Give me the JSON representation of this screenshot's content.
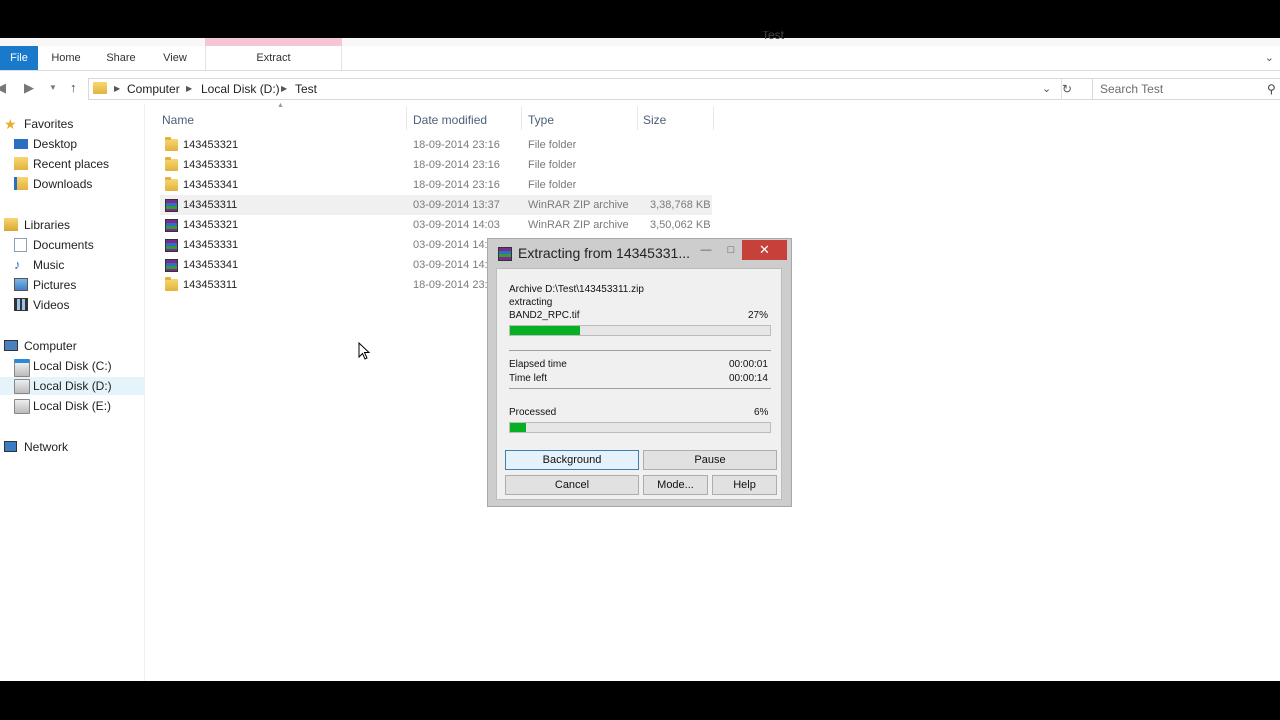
{
  "ribbon": {
    "tabs": [
      "File",
      "Home",
      "Share",
      "View",
      "Extract"
    ],
    "window_title": "Test"
  },
  "address": {
    "crumbs": [
      "Computer",
      "Local Disk (D:)",
      "Test"
    ],
    "search_placeholder": "Search Test"
  },
  "sidebar": {
    "favorites": "Favorites",
    "fav_items": [
      "Desktop",
      "Recent places",
      "Downloads"
    ],
    "libraries": "Libraries",
    "lib_items": [
      "Documents",
      "Music",
      "Pictures",
      "Videos"
    ],
    "computer": "Computer",
    "comp_items": [
      "Local Disk (C:)",
      "Local Disk (D:)",
      "Local Disk (E:)"
    ],
    "network": "Network"
  },
  "columns": {
    "name": "Name",
    "date": "Date modified",
    "type": "Type",
    "size": "Size"
  },
  "files": [
    {
      "name": "143453321",
      "date": "18-09-2014 23:16",
      "type": "File folder",
      "size": "",
      "icon": "folder-icon"
    },
    {
      "name": "143453331",
      "date": "18-09-2014 23:16",
      "type": "File folder",
      "size": "",
      "icon": "folder-icon"
    },
    {
      "name": "143453341",
      "date": "18-09-2014 23:16",
      "type": "File folder",
      "size": "",
      "icon": "folder-icon"
    },
    {
      "name": "143453311",
      "date": "03-09-2014 13:37",
      "type": "WinRAR ZIP archive",
      "size": "3,38,768 KB",
      "icon": "winrar-icon"
    },
    {
      "name": "143453321",
      "date": "03-09-2014 14:03",
      "type": "WinRAR ZIP archive",
      "size": "3,50,062 KB",
      "icon": "winrar-icon"
    },
    {
      "name": "143453331",
      "date": "03-09-2014 14:",
      "type": "",
      "size": "",
      "icon": "winrar-icon"
    },
    {
      "name": "143453341",
      "date": "03-09-2014 14:",
      "type": "",
      "size": "",
      "icon": "winrar-icon"
    },
    {
      "name": "143453311",
      "date": "18-09-2014 23:",
      "type": "",
      "size": "",
      "icon": "folder-icon"
    }
  ],
  "dialog": {
    "title": "Extracting from 14345331...",
    "archive": "Archive D:\\Test\\143453311.zip",
    "action": "extracting",
    "file": "BAND2_RPC.tif",
    "file_percent_text": "27%",
    "file_progress": 0.27,
    "elapsed_label": "Elapsed time",
    "elapsed": "00:00:01",
    "left_label": "Time left",
    "left": "00:00:14",
    "processed_label": "Processed",
    "processed_percent_text": "6%",
    "processed_progress": 0.06,
    "buttons": {
      "background": "Background",
      "pause": "Pause",
      "cancel": "Cancel",
      "mode": "Mode...",
      "help": "Help"
    },
    "close_glyph": "✕",
    "min_glyph": "—",
    "max_glyph": "□"
  }
}
